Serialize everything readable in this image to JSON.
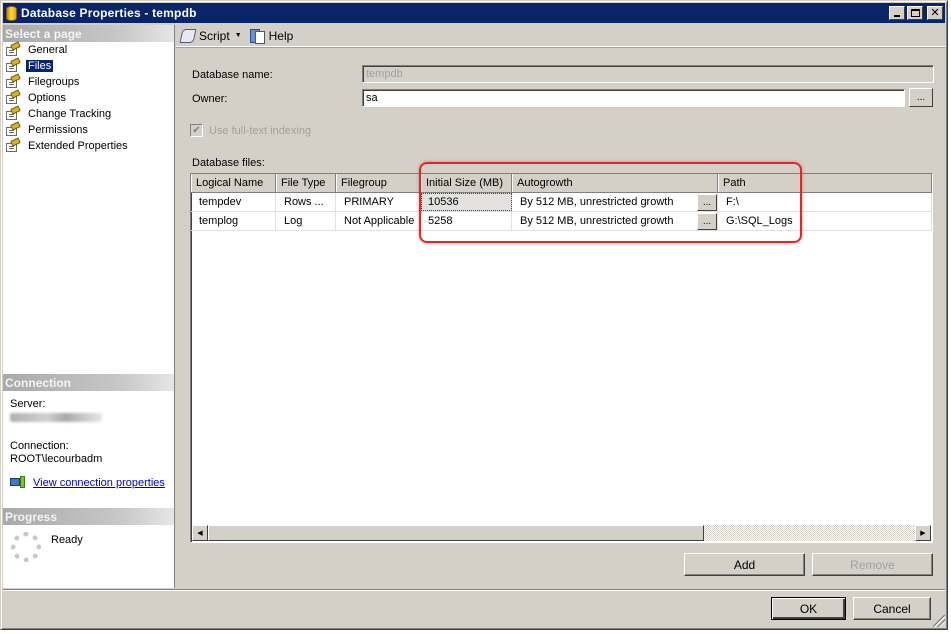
{
  "window": {
    "title": "Database Properties - tempdb",
    "controls": {
      "minimize": "_",
      "maximize": "□",
      "close": "✕"
    }
  },
  "sidebar": {
    "select_page_header": "Select a page",
    "pages": [
      {
        "label": "General",
        "icon": "page-settings-icon",
        "selected": false
      },
      {
        "label": "Files",
        "icon": "page-settings-icon",
        "selected": true
      },
      {
        "label": "Filegroups",
        "icon": "page-settings-icon",
        "selected": false
      },
      {
        "label": "Options",
        "icon": "page-settings-icon",
        "selected": false
      },
      {
        "label": "Change Tracking",
        "icon": "page-settings-icon",
        "selected": false
      },
      {
        "label": "Permissions",
        "icon": "page-settings-icon",
        "selected": false
      },
      {
        "label": "Extended Properties",
        "icon": "page-settings-icon",
        "selected": false
      }
    ],
    "connection": {
      "header": "Connection",
      "server_label": "Server:",
      "connection_label": "Connection:",
      "connection_value": "ROOT\\lecourbadm",
      "link": "View connection properties"
    },
    "progress": {
      "header": "Progress",
      "status": "Ready"
    }
  },
  "toolbar": {
    "script_label": "Script",
    "help_label": "Help"
  },
  "form": {
    "database_name_label": "Database name:",
    "database_name_value": "tempdb",
    "owner_label": "Owner:",
    "owner_value": "sa",
    "owner_browse": "...",
    "fulltext_label": "Use full-text indexing",
    "fulltext_checked": true,
    "database_files_label": "Database files:"
  },
  "grid": {
    "columns": [
      "Logical Name",
      "File Type",
      "Filegroup",
      "Initial Size (MB)",
      "Autogrowth",
      "Path"
    ],
    "rows": [
      {
        "logical_name": "tempdev",
        "file_type": "Rows ...",
        "filegroup": "PRIMARY",
        "initial_size": "10536",
        "autogrowth": "By 512 MB, unrestricted growth",
        "path": "F:\\"
      },
      {
        "logical_name": "templog",
        "file_type": "Log",
        "filegroup": "Not Applicable",
        "initial_size": "5258",
        "autogrowth": "By 512 MB, unrestricted growth",
        "path": "G:\\SQL_Logs"
      }
    ],
    "cell_button": "..."
  },
  "buttons": {
    "add": "Add",
    "remove": "Remove",
    "ok": "OK",
    "cancel": "Cancel"
  },
  "colors": {
    "titlebar": "#0a246a",
    "selection": "#0a246a",
    "highlight_annotation": "#e02828",
    "link": "#0000cc"
  }
}
